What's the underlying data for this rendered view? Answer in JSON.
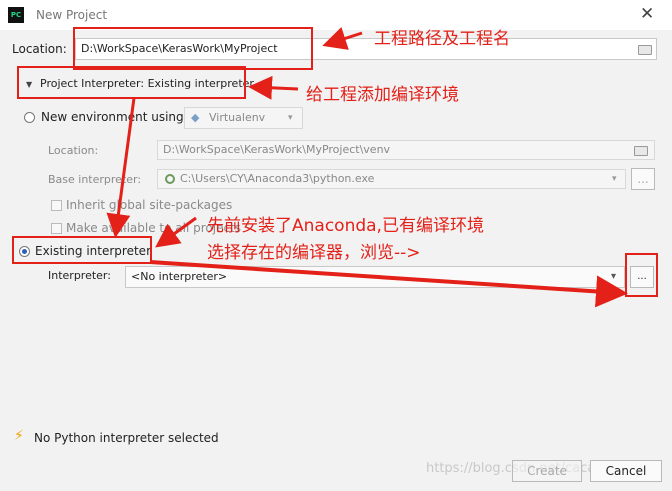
{
  "window": {
    "title": "New Project",
    "app_icon": "PC"
  },
  "location": {
    "label": "Location:",
    "value": "D:\\WorkSpace\\KerasWork\\MyProject"
  },
  "interpreter_section": {
    "label": "Project Interpreter: Existing interpreter"
  },
  "new_env": {
    "radio_label": "New environment using",
    "tool": "Virtualenv",
    "location_label": "Location:",
    "location_value": "D:\\WorkSpace\\KerasWork\\MyProject\\venv",
    "base_label": "Base interpreter:",
    "base_value": "C:\\Users\\CY\\Anaconda3\\python.exe",
    "inherit_label": "Inherit global site-packages",
    "available_label": "Make available to all projects"
  },
  "existing": {
    "radio_label": "Existing interpreter",
    "interpreter_label": "Interpreter:",
    "interpreter_value": "<No interpreter>",
    "browse_label": "..."
  },
  "warning": {
    "text": "No Python interpreter selected"
  },
  "buttons": {
    "create": "Create",
    "cancel": "Cancel"
  },
  "watermark": "https://blog.csdn.net/cacacarcy_wu",
  "annotations": {
    "path": "工程路径及工程名",
    "env": "给工程添加编译环境",
    "anaconda_line1": "先前安装了Anaconda,已有编译环境",
    "anaconda_line2": "选择存在的编译器，浏览-->"
  },
  "colors": {
    "annotation_red": "#e32119",
    "radio_blue": "#2c5fbb",
    "warning_yellow": "#f0a30a"
  }
}
